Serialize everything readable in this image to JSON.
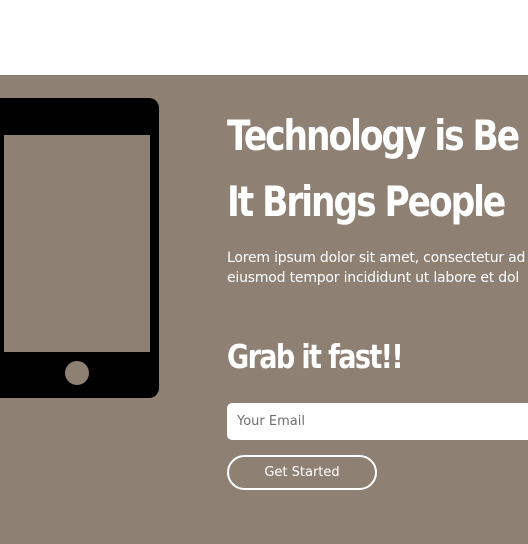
{
  "colors": {
    "hero_background": "#8e8174",
    "text": "#ffffff",
    "phone": "#000000"
  },
  "hero": {
    "headline_lines": [
      "Technology is Be",
      "It Brings People"
    ],
    "description_lines": [
      "Lorem ipsum dolor sit amet, consectetur ad",
      "eiusmod tempor incididunt ut labore et dol"
    ],
    "subheading": "Grab it fast!!",
    "email_placeholder": "Your Email",
    "email_value": "",
    "cta_label": "Get Started",
    "illustration_icon": "smartphone-icon"
  }
}
